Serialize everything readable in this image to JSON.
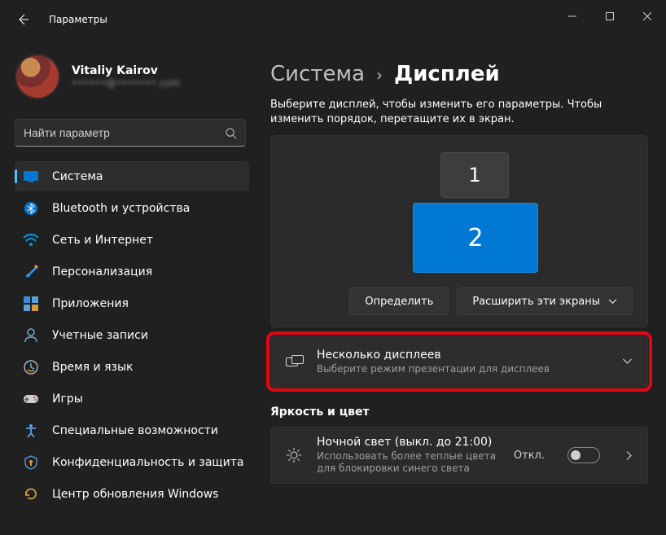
{
  "titlebar": {
    "app": "Параметры"
  },
  "user": {
    "name": "Vitaliy Kairov",
    "email": "••••••@•••••••.com"
  },
  "search": {
    "placeholder": "Найти параметр"
  },
  "nav": [
    {
      "id": "system",
      "label": "Система",
      "active": true
    },
    {
      "id": "bluetooth",
      "label": "Bluetooth и устройства"
    },
    {
      "id": "network",
      "label": "Сеть и Интернет"
    },
    {
      "id": "personalization",
      "label": "Персонализация"
    },
    {
      "id": "apps",
      "label": "Приложения"
    },
    {
      "id": "accounts",
      "label": "Учетные записи"
    },
    {
      "id": "time",
      "label": "Время и язык"
    },
    {
      "id": "gaming",
      "label": "Игры"
    },
    {
      "id": "accessibility",
      "label": "Специальные возможности"
    },
    {
      "id": "privacy",
      "label": "Конфиденциальность и защита"
    },
    {
      "id": "update",
      "label": "Центр обновления Windows"
    }
  ],
  "crumb": {
    "root": "Система",
    "leaf": "Дисплей"
  },
  "subtext": "Выберите дисплей, чтобы изменить его параметры. Чтобы изменить порядок, перетащите их в экран.",
  "monitors": {
    "m1": "1",
    "m2": "2"
  },
  "actions": {
    "identify": "Определить",
    "extend": "Расширить эти экраны"
  },
  "multiple": {
    "title": "Несколько дисплеев",
    "sub": "Выберите режим презентации для дисплеев"
  },
  "section_brightness": "Яркость и цвет",
  "nightlight": {
    "title": "Ночной свет (выкл. до 21:00)",
    "sub": "Использовать более теплые цвета для блокировки синего света",
    "status": "Откл."
  }
}
